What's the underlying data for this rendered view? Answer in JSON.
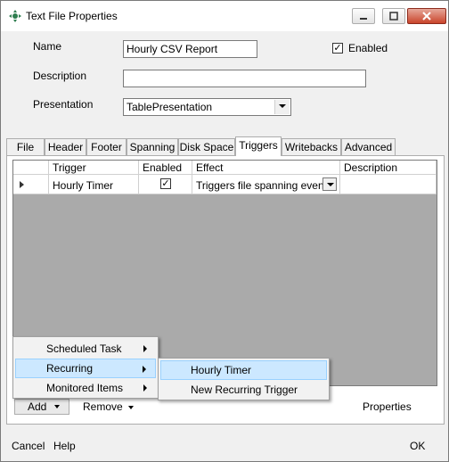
{
  "window": {
    "title": "Text File Properties"
  },
  "form": {
    "name_label": "Name",
    "name_value": "Hourly CSV Report",
    "enabled_label": "Enabled",
    "enabled_checked": "✓",
    "description_label": "Description",
    "description_value": "",
    "presentation_label": "Presentation",
    "presentation_value": "TablePresentation"
  },
  "tabs": [
    "File",
    "Header",
    "Footer",
    "Spanning",
    "Disk Space",
    "Triggers",
    "Writebacks",
    "Advanced"
  ],
  "active_tab": "Triggers",
  "grid": {
    "headers": [
      "",
      "Trigger",
      "Enabled",
      "Effect",
      "Description"
    ],
    "rows": [
      {
        "trigger": "Hourly Timer",
        "enabled": "✓",
        "effect": "Triggers file spanning event",
        "description": ""
      }
    ]
  },
  "add_menu": {
    "items": [
      "Scheduled Task",
      "Recurring",
      "Monitored Items"
    ],
    "highlighted": "Recurring"
  },
  "recurring_submenu": {
    "items": [
      "Hourly Timer",
      "New Recurring Trigger"
    ],
    "highlighted": "Hourly Timer"
  },
  "panel_buttons": {
    "add": "Add",
    "remove": "Remove",
    "properties": "Properties"
  },
  "footer": {
    "cancel": "Cancel",
    "help": "Help",
    "ok": "OK"
  },
  "colors": {
    "highlight": "#cce8ff",
    "grid_background": "#aaaaaa",
    "close_button": "#c9442b"
  }
}
